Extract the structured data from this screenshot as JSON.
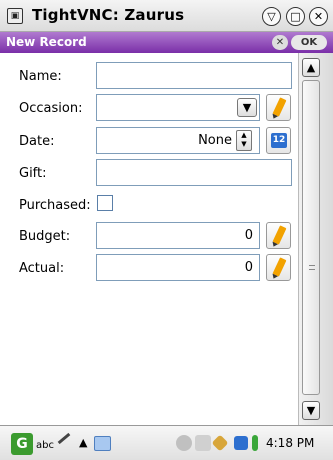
{
  "window": {
    "title": "TightVNC: Zaurus"
  },
  "dialog": {
    "title": "New Record",
    "ok_label": "OK",
    "close_label": "✕"
  },
  "form": {
    "name": {
      "label": "Name:",
      "value": ""
    },
    "occasion": {
      "label": "Occasion:",
      "value": ""
    },
    "date": {
      "label": "Date:",
      "value": "None",
      "calendar_label": "12"
    },
    "gift": {
      "label": "Gift:",
      "value": ""
    },
    "purchased": {
      "label": "Purchased:",
      "checked": false
    },
    "budget": {
      "label": "Budget:",
      "value": "0"
    },
    "actual": {
      "label": "Actual:",
      "value": "0"
    }
  },
  "taskbar": {
    "input_method": "abc",
    "clock": "4:18 PM"
  },
  "icons": {
    "app": "vnc-icon",
    "minimize": "minimize-icon",
    "maximize": "maximize-icon",
    "close": "close-icon",
    "edit": "pencil-icon",
    "calendar": "calendar-icon",
    "scroll_up": "chevron-up-icon",
    "scroll_down": "chevron-down-icon"
  },
  "colors": {
    "dialog_header": "#7a2fa8",
    "field_border": "#7f9db9",
    "edit_accent": "#f2a200",
    "calendar": "#2d6fcf"
  }
}
